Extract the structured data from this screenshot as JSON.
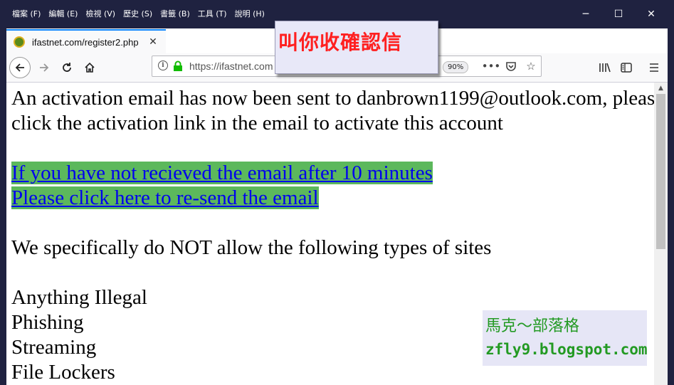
{
  "menu": [
    "檔案 (F)",
    "編輯 (E)",
    "檢視 (V)",
    "歷史 (S)",
    "書籤 (B)",
    "工具 (T)",
    "說明 (H)"
  ],
  "window_controls": {
    "minimize": "─",
    "maximize": "☐",
    "close": "✕"
  },
  "tab": {
    "title": "ifastnet.com/register2.php",
    "close": "✕"
  },
  "newtab": "+",
  "urlbar": {
    "url": "https://ifastnet.com",
    "zoom": "90%"
  },
  "annotation": "叫你收確認信",
  "content": {
    "line1": "An activation email has now been sent to danbrown1199@outlook.com, please",
    "line2": "click the activation link in the email to activate this account",
    "link1": "If you have not recieved the email after 10 minutes",
    "link2": "Please click here to re-send the email",
    "notice": "We specifically do NOT allow the following types of sites",
    "list": [
      "Anything Illegal",
      "Phishing",
      "Streaming",
      "File Lockers"
    ]
  },
  "watermark": {
    "line1": "馬克～部落格",
    "line2": "zfly9.blogspot.com"
  },
  "colors": {
    "frame": "#1f2240",
    "link": "#0000ee",
    "link_highlight": "#5cb85c",
    "annotation_text": "#ff2020",
    "watermark_text": "#239a23"
  }
}
